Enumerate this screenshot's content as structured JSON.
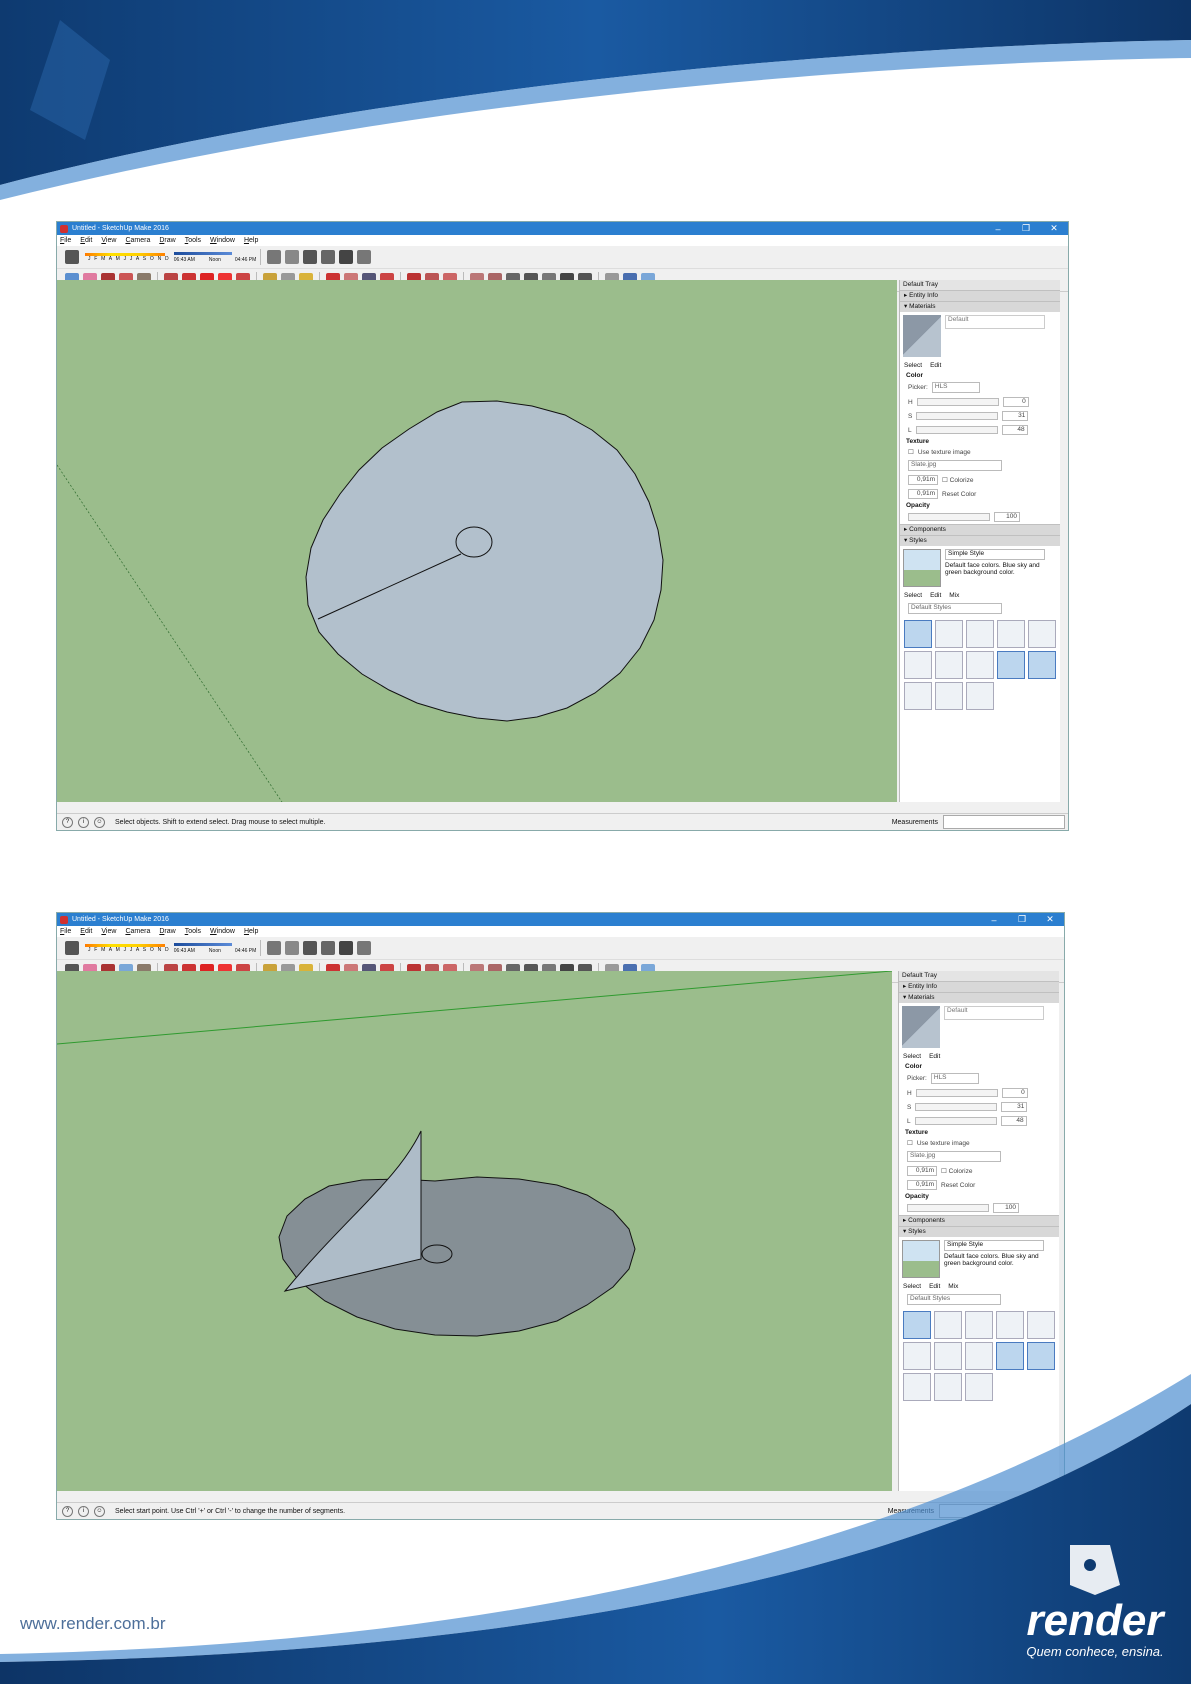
{
  "footer": {
    "url": "www.render.com.br"
  },
  "logo": {
    "brand": "render",
    "tagline": "Quem conhece, ensina."
  },
  "screens": [
    {
      "title": "Untitled - SketchUp Make 2016",
      "menus": [
        "File",
        "Edit",
        "View",
        "Camera",
        "Draw",
        "Tools",
        "Window",
        "Help"
      ],
      "months": "J F M A M J J A S O N D",
      "times": {
        "start": "06:43 AM",
        "noon": "Noon",
        "end": "04:46 PM"
      },
      "status_message": "Select objects. Shift to extend select. Drag mouse to select multiple.",
      "measurements_label": "Measurements",
      "tray": {
        "title": "Default Tray",
        "entity_info": "Entity Info",
        "materials": "Materials",
        "material_name": "Default",
        "tab_select": "Select",
        "tab_edit": "Edit",
        "color_label": "Color",
        "picker_label": "Picker:",
        "picker_value": "HLS",
        "h_label": "H",
        "h_value": "0",
        "s_label": "S",
        "s_value": "31",
        "l_label": "L",
        "l_value": "48",
        "texture_label": "Texture",
        "use_texture": "Use texture image",
        "texture_file": "Slate.jpg",
        "width_value": "0,91m",
        "height_value": "0,91m",
        "colorize": "Colorize",
        "reset_color": "Reset Color",
        "opacity_label": "Opacity",
        "opacity_value": "100",
        "components": "Components",
        "styles": "Styles",
        "style_name": "Simple Style",
        "style_desc": "Default face colors. Blue sky and green background color.",
        "style_tab_select": "Select",
        "style_tab_edit": "Edit",
        "style_tab_mix": "Mix",
        "style_collection": "Default Styles"
      }
    },
    {
      "title": "Untitled - SketchUp Make 2016",
      "menus": [
        "File",
        "Edit",
        "View",
        "Camera",
        "Draw",
        "Tools",
        "Window",
        "Help"
      ],
      "months": "J F M A M J J A S O N D",
      "times": {
        "start": "06:43 AM",
        "noon": "Noon",
        "end": "04:46 PM"
      },
      "status_message": "Select start point. Use Ctrl '+' or Ctrl '-' to change the number of segments.",
      "measurements_label": "Measurements",
      "tray": {
        "title": "Default Tray",
        "entity_info": "Entity Info",
        "materials": "Materials",
        "material_name": "Default",
        "tab_select": "Select",
        "tab_edit": "Edit",
        "color_label": "Color",
        "picker_label": "Picker:",
        "picker_value": "HLS",
        "h_label": "H",
        "h_value": "0",
        "s_label": "S",
        "s_value": "31",
        "l_label": "L",
        "l_value": "48",
        "texture_label": "Texture",
        "use_texture": "Use texture image",
        "texture_file": "Slate.jpg",
        "width_value": "0,91m",
        "height_value": "0,91m",
        "colorize": "Colorize",
        "reset_color": "Reset Color",
        "opacity_label": "Opacity",
        "opacity_value": "100",
        "components": "Components",
        "styles": "Styles",
        "style_name": "Simple Style",
        "style_desc": "Default face colors. Blue sky and green background color.",
        "style_tab_select": "Select",
        "style_tab_edit": "Edit",
        "style_tab_mix": "Mix",
        "style_collection": "Default Styles"
      }
    }
  ],
  "colors": {
    "viewport": "#9bbd8c",
    "titlebar": "#2b7fd0",
    "banner_dark": "#0f3b73",
    "banner_light": "#1f63ad"
  }
}
